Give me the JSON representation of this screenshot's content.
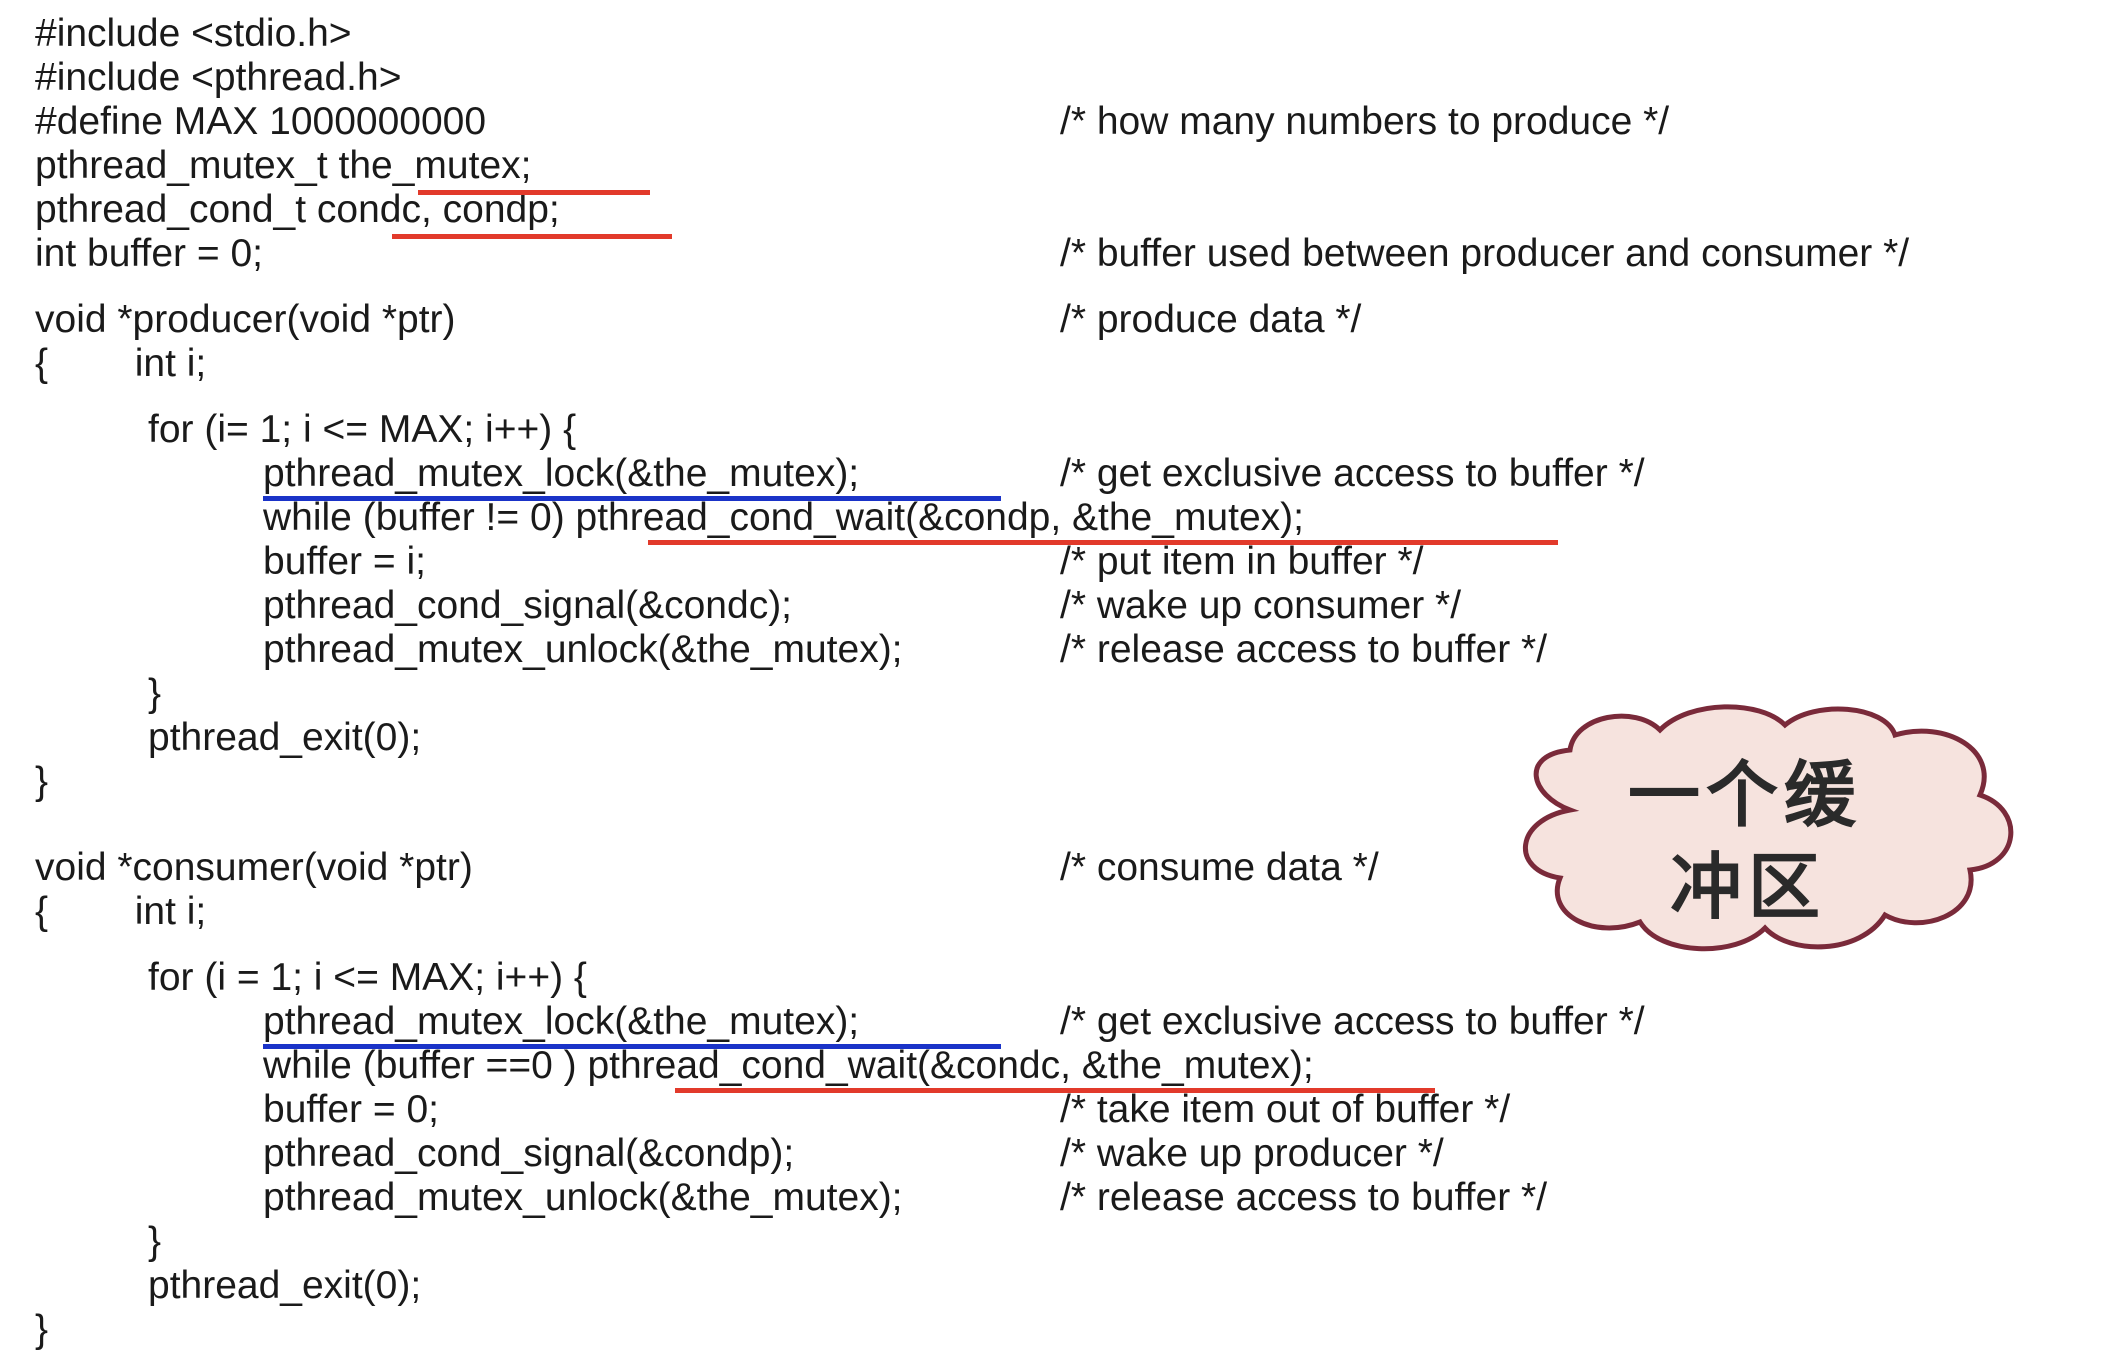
{
  "code": {
    "l1": "#include <stdio.h>",
    "l2": "#include <pthread.h>",
    "l3": "#define MAX 1000000000",
    "l3c": "/* how many numbers to produce */",
    "l4": "pthread_mutex_t the_mutex;",
    "l5": "pthread_cond_t condc, condp;",
    "l6": "int buffer = 0;",
    "l6c": "/* buffer used between producer and consumer */",
    "p_sig": "void *producer(void *ptr)",
    "p_sigc": "/* produce data */",
    "p_open": "{        int i;",
    "p_for": "for (i= 1; i <= MAX; i++) {",
    "p_lock": "pthread_mutex_lock(&the_mutex);",
    "p_lockc": "/* get exclusive access to buffer */",
    "p_while": "while (buffer != 0) pthread_cond_wait(&condp, &the_mutex);",
    "p_assign": "buffer = i;",
    "p_assignc": "/* put item in buffer */",
    "p_signal": "pthread_cond_signal(&condc);",
    "p_signalc": "/* wake up consumer */",
    "p_unlock": "pthread_mutex_unlock(&the_mutex);",
    "p_unlockc": "/* release access to buffer */",
    "p_close_for": "}",
    "p_exit": "pthread_exit(0);",
    "p_close": "}",
    "c_sig": "void *consumer(void *ptr)",
    "c_sigc": "/* consume data */",
    "c_open": "{        int i;",
    "c_for": "for (i = 1; i <= MAX; i++) {",
    "c_lock": "pthread_mutex_lock(&the_mutex);",
    "c_lockc": "/* get exclusive access to buffer */",
    "c_while": "while (buffer ==0 ) pthread_cond_wait(&condc, &the_mutex);",
    "c_assign": "buffer = 0;",
    "c_assignc": "/* take item out of buffer */",
    "c_signal": "pthread_cond_signal(&condp);",
    "c_signalc": "/* wake up producer */",
    "c_unlock": "pthread_mutex_unlock(&the_mutex);",
    "c_unlockc": "/* release access to buffer */",
    "c_close_for": "}",
    "c_exit": "pthread_exit(0);",
    "c_close": "}"
  },
  "callout": {
    "line1": "一个缓",
    "line2": "冲区",
    "fill": "#f6e3de",
    "stroke": "#7a2a3a"
  },
  "colors": {
    "underline_red": "#e23a2b",
    "underline_blue": "#1a33c8"
  }
}
